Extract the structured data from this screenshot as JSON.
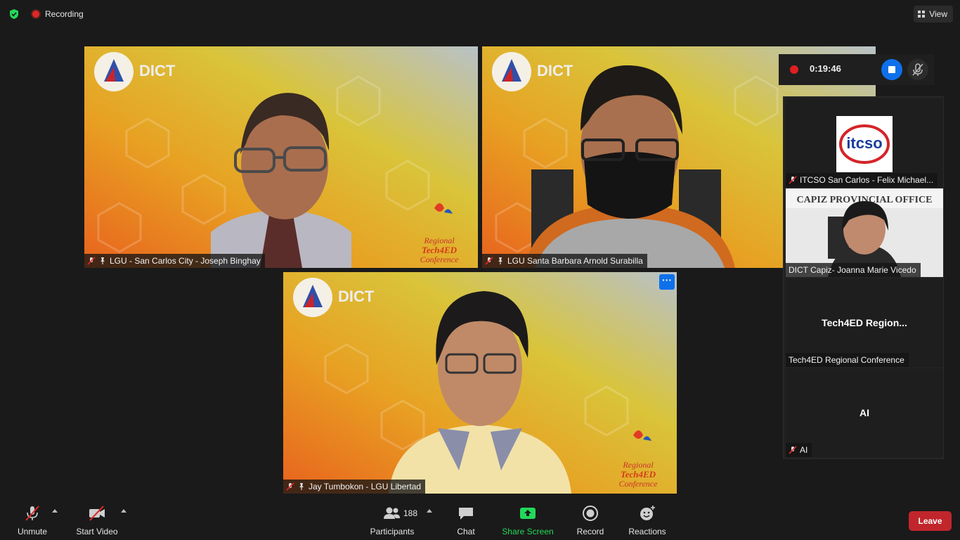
{
  "status": {
    "recording_label": "Recording",
    "view_label": "View"
  },
  "recording_panel": {
    "elapsed": "0:19:46"
  },
  "gallery": {
    "tiles": [
      {
        "name": "LGU - San Carlos City - Joseph Binghay"
      },
      {
        "name": "LGU Santa Barbara Arnold Surabilla"
      },
      {
        "name": "Jay Tumbokon - LGU Libertad",
        "more_label": "···"
      }
    ]
  },
  "side_panel": {
    "tiles": [
      {
        "name": "ITCSO San Carlos - Felix Michael...",
        "logo_text": "itcso"
      },
      {
        "name": "DICT Capiz- Joanna Marie Vicedo",
        "sign_text": "CAPIZ PROVINCIAL OFFICE"
      },
      {
        "name": "Tech4ED Regional Conference",
        "center_text": "Tech4ED  Region..."
      },
      {
        "name": "AI",
        "center_text": "AI"
      }
    ]
  },
  "background": {
    "logo_text": "DICT",
    "event_text": "Regional",
    "event_text2": "Tech4ED",
    "event_text3": "Conference"
  },
  "toolbar": {
    "unmute": "Unmute",
    "start_video": "Start Video",
    "participants": "Participants",
    "participants_count": "188",
    "chat": "Chat",
    "share_screen": "Share Screen",
    "record": "Record",
    "reactions": "Reactions",
    "leave": "Leave"
  },
  "colors": {
    "accent": "#0e71eb",
    "share_green": "#23d959",
    "leave_red": "#c0262c",
    "rec_red": "#e02020"
  }
}
